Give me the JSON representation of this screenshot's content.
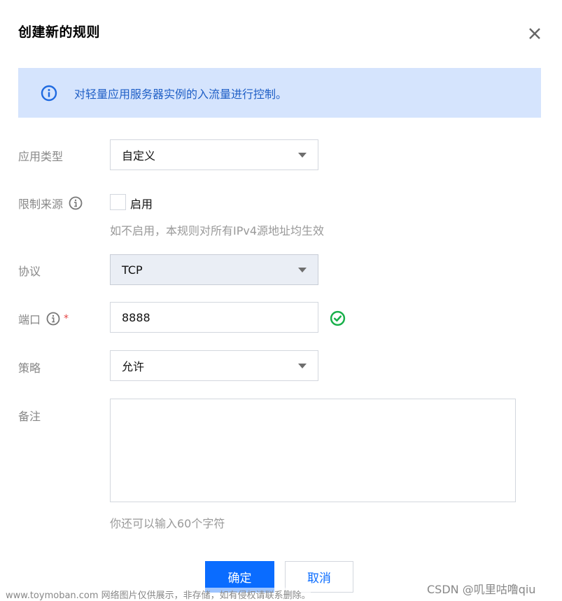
{
  "dialog": {
    "title": "创建新的规则",
    "close_icon": "close-icon"
  },
  "banner": {
    "icon": "info-icon",
    "text": "对轻量应用服务器实例的入流量进行控制。",
    "color": "#1f5fc6",
    "background": "#d5e4fd"
  },
  "form": {
    "app_type": {
      "label": "应用类型",
      "value": "自定义"
    },
    "source_limit": {
      "label": "限制来源",
      "checkbox_label": "启用",
      "checked": false,
      "hint": "如不启用，本规则对所有IPv4源地址均生效"
    },
    "protocol": {
      "label": "协议",
      "value": "TCP",
      "disabled": true
    },
    "port": {
      "label": "端口",
      "required_mark": "*",
      "value": "8888",
      "status_icon": "check-circle-icon"
    },
    "policy": {
      "label": "策略",
      "value": "允许"
    },
    "remark": {
      "label": "备注",
      "value": "",
      "hint": "你还可以输入60个字符"
    }
  },
  "footer": {
    "confirm_label": "确定",
    "cancel_label": "取消",
    "primary_color": "#0a6cff"
  },
  "watermarks": {
    "left": "www.toymoban.com 网络图片仅供展示，非存储，如有侵权请联系删除。",
    "right": "CSDN @叽里咕噜qiu"
  }
}
